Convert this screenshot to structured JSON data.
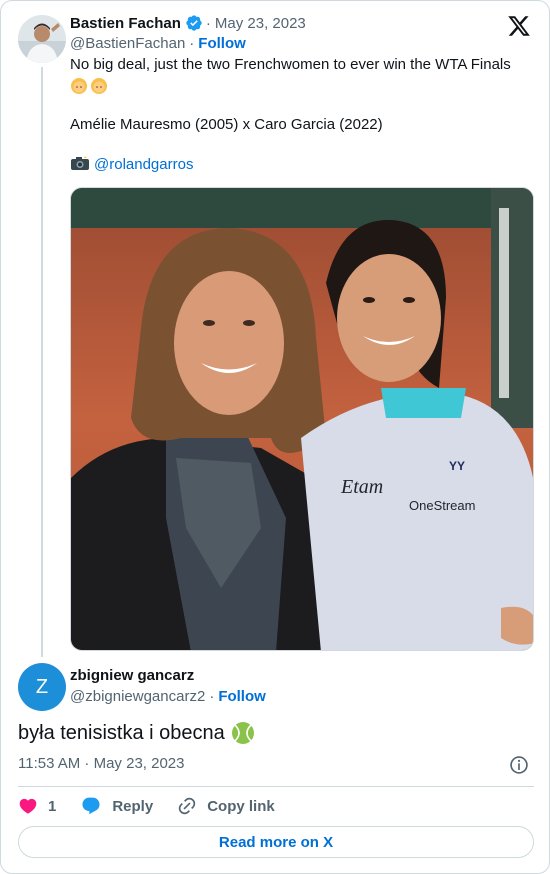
{
  "tweet": {
    "author_name": "Bastien Fachan",
    "date": "May 23, 2023",
    "handle": "@BastienFachan",
    "follow_label": "Follow",
    "lines": [
      "No big deal, just the two Frenchwomen to ever win the WTA Finals",
      "👱‍♀️👱‍♀️",
      "",
      "Amélie Mauresmo (2005) x Caro Garcia (2022)",
      "",
      "📸 "
    ],
    "mention": "@rolandgarros",
    "separator": "·"
  },
  "reply": {
    "author_name": "zbigniew gancarz",
    "avatar_letter": "Z",
    "handle": "@zbigniewgancarz2",
    "follow_label": "Follow",
    "text": "była tenisistka i obecna",
    "timestamp": "11:53 AM · May 23, 2023",
    "like_count": "1",
    "reply_label": "Reply",
    "copy_link_label": "Copy link",
    "read_more_label": "Read more on X",
    "separator": "·"
  },
  "icons": {
    "verified": "verified-badge-icon",
    "x_logo": "x-logo-icon",
    "info": "info-icon",
    "heart": "heart-icon",
    "reply": "reply-bubble-icon",
    "link": "link-icon",
    "tennis_ball": "tennis-ball-icon"
  },
  "colors": {
    "link_blue": "#006fd6",
    "verified_blue": "#1d9bf0",
    "heart_pink": "#f91880",
    "muted": "#536471",
    "border": "#cfd9de"
  }
}
